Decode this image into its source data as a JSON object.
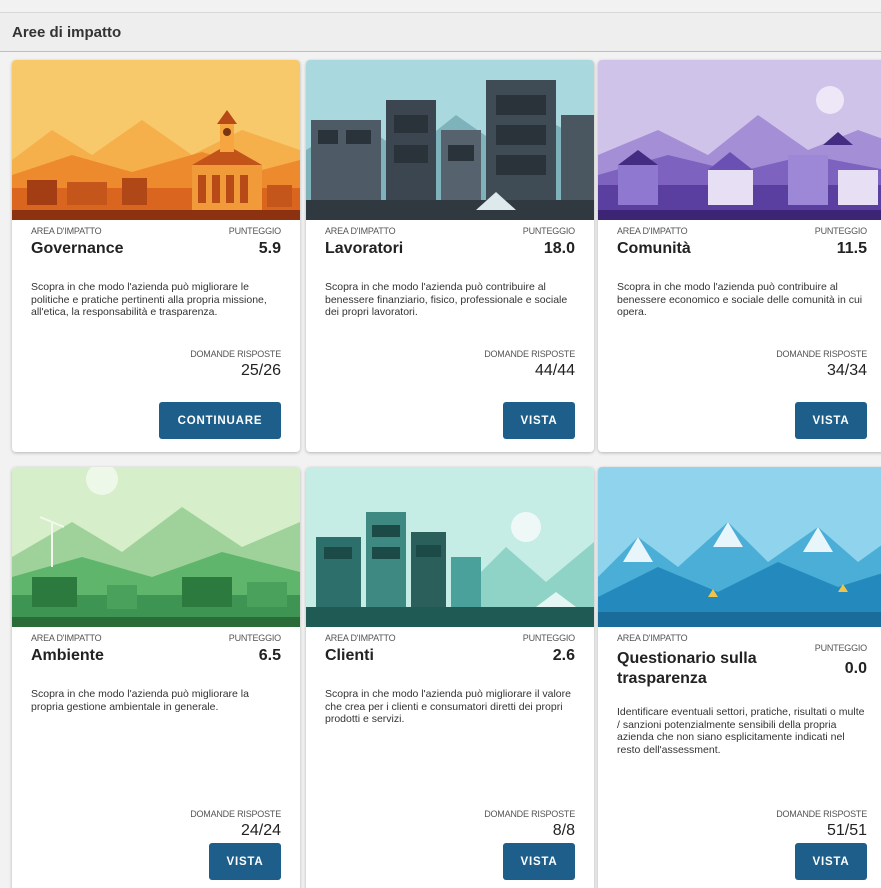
{
  "section": {
    "title": "Aree di impatto"
  },
  "labels": {
    "area": "AREA D'IMPATTO",
    "score": "PUNTEGGIO",
    "answered": "DOMANDE RISPOSTE"
  },
  "colors": {
    "button": "#1d5f8a",
    "header_bg": "#eeeeee"
  },
  "cards": [
    {
      "name": "Governance",
      "score": "5.9",
      "description": "Scopra in che modo l'azienda può migliorare le politiche e pratiche pertinenti alla propria missione, all'etica, la responsabilità e trasparenza.",
      "answered": "25/26",
      "button": "CONTINUARE",
      "art": "orange-village-illustration"
    },
    {
      "name": "Lavoratori",
      "score": "18.0",
      "description": "Scopra in che modo l'azienda può contribuire al benessere finanziario, fisico, professionale e sociale dei propri lavoratori.",
      "answered": "44/44",
      "button": "VISTA",
      "art": "dark-city-illustration"
    },
    {
      "name": "Comunità",
      "score": "11.5",
      "description": "Scopra in che modo l'azienda può contribuire al benessere economico e sociale delle comunità in cui opera.",
      "answered": "34/34",
      "button": "VISTA",
      "art": "purple-town-illustration"
    },
    {
      "name": "Ambiente",
      "score": "6.5",
      "description": "Scopra in che modo l'azienda può migliorare la propria gestione ambientale in generale.",
      "answered": "24/24",
      "button": "VISTA",
      "art": "green-landscape-illustration"
    },
    {
      "name": "Clienti",
      "score": "2.6",
      "description": "Scopra in che modo l'azienda può migliorare il valore che crea per i clienti e consumatori diretti dei propri prodotti e servizi.",
      "answered": "8/8",
      "button": "VISTA",
      "art": "teal-city-illustration"
    },
    {
      "name": "Questionario sulla trasparenza",
      "score": "0.0",
      "description": "Identificare eventuali settori, pratiche, risultati o multe / sanzioni potenzialmente sensibili della propria azienda che non siano esplicitamente indicati nel resto dell'assessment.",
      "answered": "51/51",
      "button": "VISTA",
      "art": "blue-mountains-illustration"
    }
  ]
}
